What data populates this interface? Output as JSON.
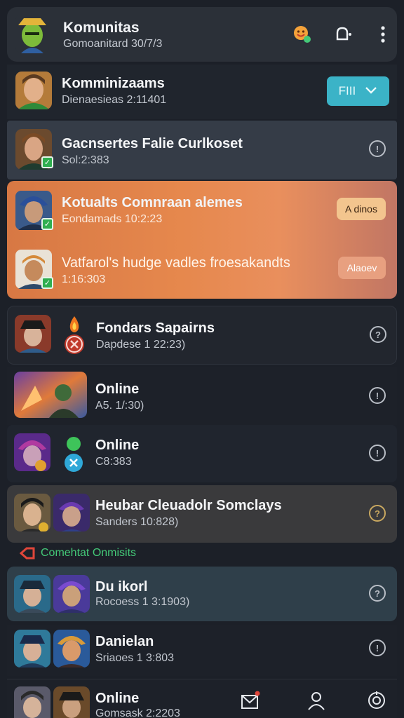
{
  "header": {
    "title": "Komunitas",
    "subtitle": "Gomoanitard 30/7/3",
    "icons": [
      "emoji-icon",
      "bell-icon",
      "more-vertical-icon"
    ]
  },
  "rows": [
    {
      "name": "Komminizaams",
      "meta": "Dienaesieas 2:11401",
      "action": "FIII"
    },
    {
      "name": "Gacnsertes Falie Curlkoset",
      "meta": "Sol:2:383"
    },
    {
      "name": "Kotualts Comnraan alemes",
      "meta": "Eondamads 10:2:23",
      "action": "A dinos"
    },
    {
      "name": "Vatfarol's hudge vadles froesakandts",
      "meta": "1:16:303",
      "action": "Alaoev"
    },
    {
      "name": "Fondars Sapairns",
      "meta": "Dapdese 1 22:23)"
    },
    {
      "name": "Online",
      "meta": "A5. 1/:30)"
    },
    {
      "name": "Online",
      "meta": "C8:383"
    },
    {
      "name": "Heubar Cleuadolr Somclays",
      "meta": "Sanders 10:828)"
    },
    {
      "name": "Du ikorl",
      "meta": "Rocoess 1 3:1903)"
    },
    {
      "name": "Danielan",
      "meta": "Sriaoes 1 3:803"
    },
    {
      "name": "Online",
      "meta": "Gomsask 2:2203"
    }
  ],
  "section_label": "Comehtat Onmisits",
  "bottom_nav": [
    "mail-icon",
    "profile-icon",
    "settings-icon"
  ],
  "colors": {
    "background": "#1c2028",
    "accent_teal": "#3bb3c7",
    "accent_orange": "#e6884d",
    "online_green": "#2fae4f"
  }
}
